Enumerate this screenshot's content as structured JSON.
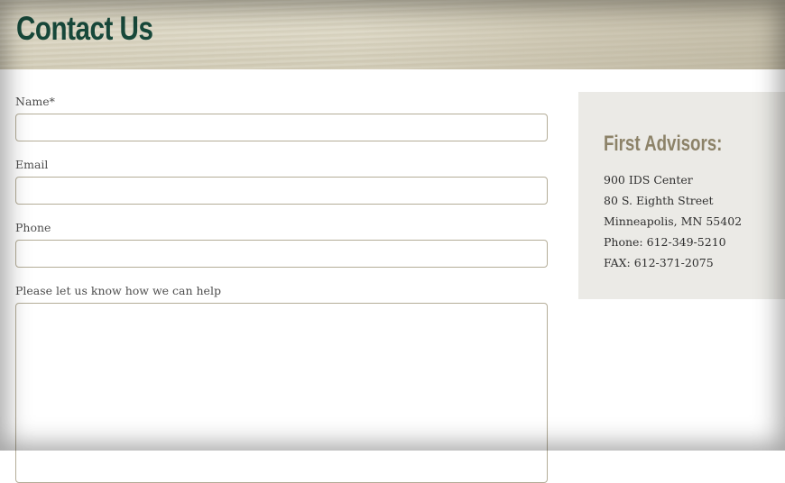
{
  "header": {
    "title": "Contact Us"
  },
  "form": {
    "name_label": "Name*",
    "name_value": "",
    "email_label": "Email",
    "email_value": "",
    "phone_label": "Phone",
    "phone_value": "",
    "message_label": "Please let us know how we can help",
    "message_value": ""
  },
  "sidebar": {
    "company": "First Advisors:",
    "lines": [
      "900 IDS Center",
      "80 S. Eighth Street",
      "Minneapolis, MN 55402",
      "Phone: 612-349-5210",
      "FAX: 612-371-2075"
    ]
  },
  "colors": {
    "title": "#17483a",
    "company": "#8c8268",
    "sidebar_bg": "#ebeae6",
    "input_border": "#b4ad98"
  }
}
